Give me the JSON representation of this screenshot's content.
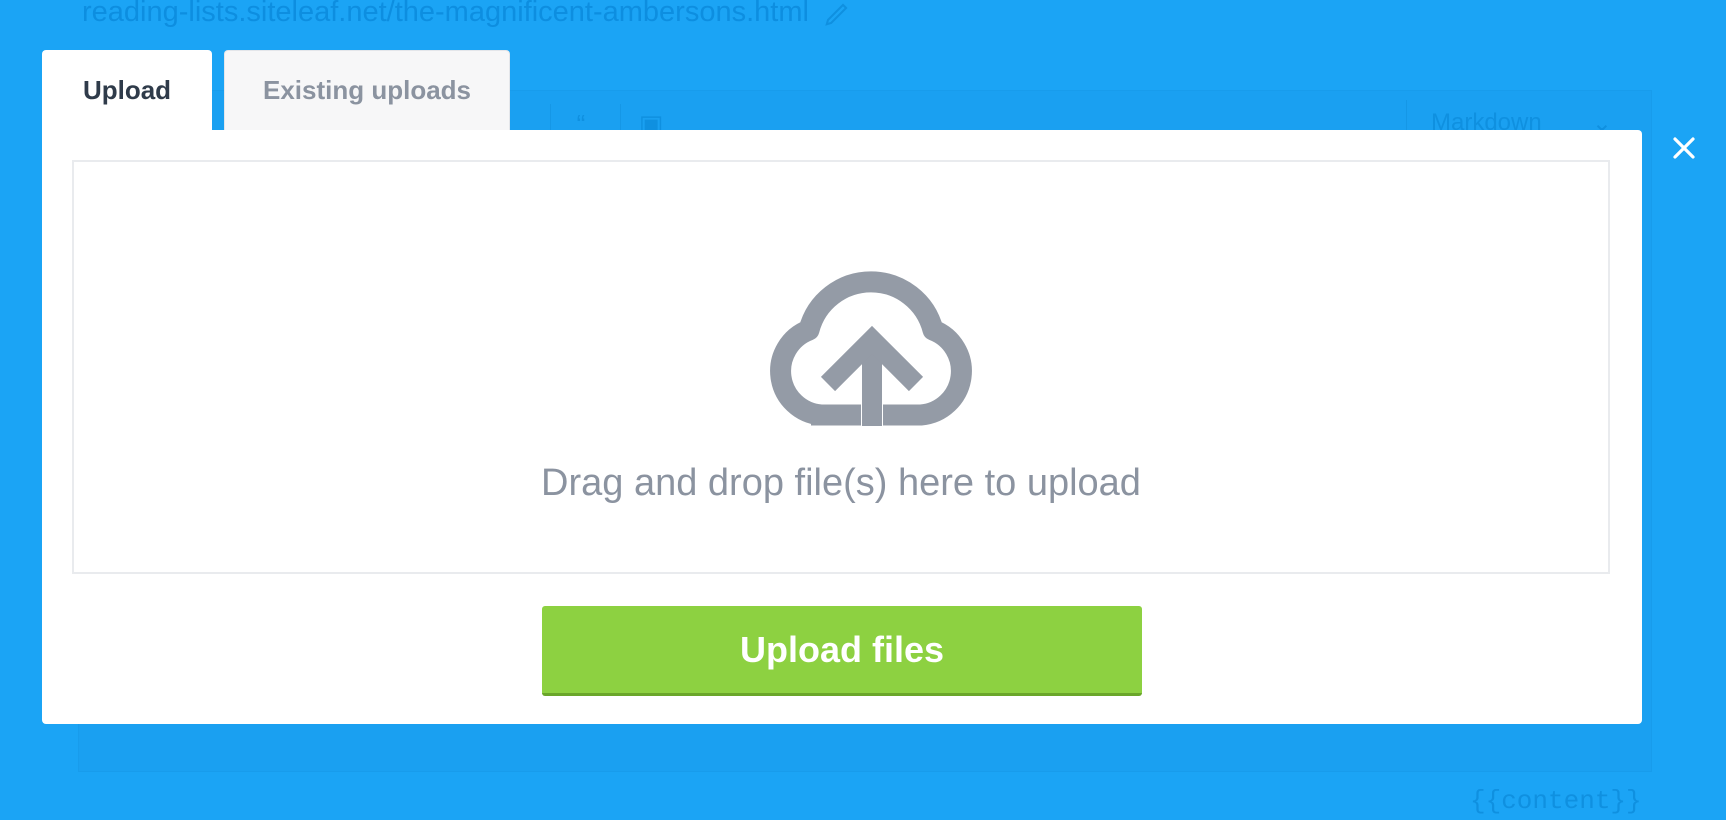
{
  "background": {
    "url_text": "reading-lists.siteleaf.net/the-magnificent-ambersons.html",
    "format_select": "Markdown",
    "content_tag": "{{content}}"
  },
  "tabs": [
    {
      "label": "Upload",
      "active": true
    },
    {
      "label": "Existing uploads",
      "active": false
    }
  ],
  "dropzone": {
    "icon": "cloud-upload-icon",
    "text": "Drag and drop file(s) here to upload"
  },
  "upload_button": {
    "label": "Upload files"
  },
  "close_icon": "close-icon",
  "colors": {
    "backdrop": "#1ba4f5",
    "button_green": "#8dd141",
    "icon_gray": "#949ba6",
    "text_dark": "#2f3b4a",
    "text_gray": "#8b93a0"
  }
}
